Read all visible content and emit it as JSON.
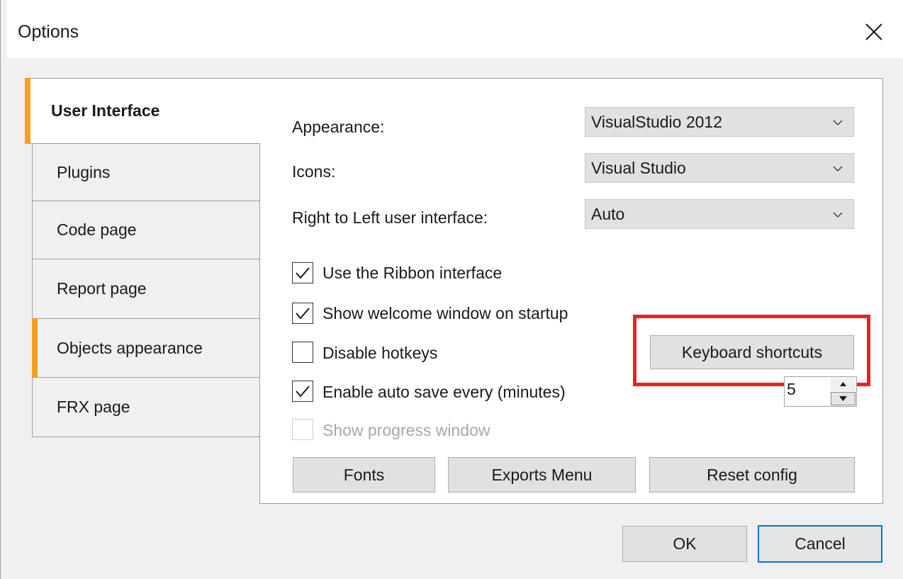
{
  "window": {
    "title": "Options",
    "close_icon": "close-icon"
  },
  "tabs": [
    {
      "label": "User Interface",
      "active": true
    },
    {
      "label": "Plugins",
      "active": false
    },
    {
      "label": "Code page",
      "active": false
    },
    {
      "label": "Report page",
      "active": false
    },
    {
      "label": "Objects appearance",
      "active": false
    },
    {
      "label": "FRX page",
      "active": false
    }
  ],
  "settings": {
    "appearance_label": "Appearance:",
    "appearance_value": "VisualStudio 2012",
    "icons_label": "Icons:",
    "icons_value": "Visual Studio",
    "rtl_label": "Right to Left user interface:",
    "rtl_value": "Auto"
  },
  "checkboxes": [
    {
      "label": "Use the Ribbon interface",
      "checked": true,
      "enabled": true
    },
    {
      "label": "Show welcome window on startup",
      "checked": true,
      "enabled": true
    },
    {
      "label": "Disable hotkeys",
      "checked": false,
      "enabled": true
    },
    {
      "label": "Enable auto save every (minutes)",
      "checked": true,
      "enabled": true
    },
    {
      "label": "Show progress window",
      "checked": false,
      "enabled": false
    }
  ],
  "autosave_minutes": "5",
  "buttons": {
    "keyboard_shortcuts": "Keyboard shortcuts",
    "fonts": "Fonts",
    "exports_menu": "Exports Menu",
    "reset_config": "Reset config",
    "ok": "OK",
    "cancel": "Cancel"
  },
  "colors": {
    "tab_accent": "#f2a11f",
    "highlight": "#e8212b",
    "primary_border": "#0078d7"
  }
}
